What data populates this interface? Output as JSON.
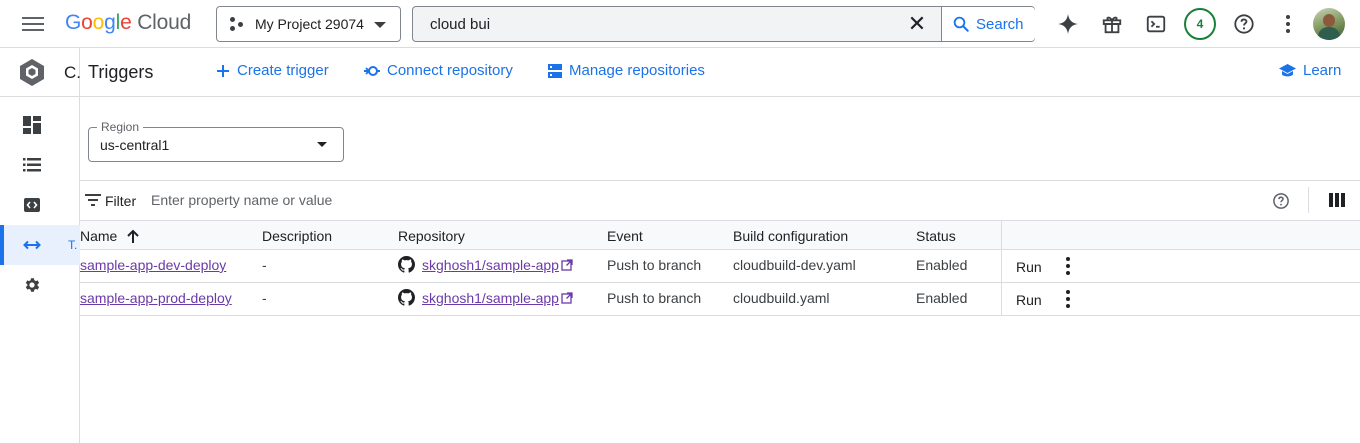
{
  "topbar": {
    "logo_google": "Google",
    "logo_cloud": "Cloud",
    "project_name": "My Project 29074",
    "search_value": "cloud bui",
    "search_button": "Search",
    "notifications_count": "4",
    "icons": [
      "menu-icon",
      "gemini-sparkle-icon",
      "gift-icon",
      "cloud-shell-icon",
      "help-icon",
      "more-vert-icon"
    ]
  },
  "rail": {
    "product_name": "C.",
    "items": [
      {
        "icon": "dashboard-icon"
      },
      {
        "icon": "history-list-icon"
      },
      {
        "icon": "code-icon"
      },
      {
        "icon": "triggers-arrow-icon",
        "label": "T.",
        "active": true
      },
      {
        "icon": "settings-gear-icon"
      }
    ]
  },
  "header": {
    "title": "Triggers",
    "create_trigger": "Create trigger",
    "connect_repository": "Connect repository",
    "manage_repositories": "Manage repositories",
    "learn": "Learn"
  },
  "region": {
    "label": "Region",
    "value": "us-central1"
  },
  "filter": {
    "label": "Filter",
    "placeholder": "Enter property name or value"
  },
  "table": {
    "columns": [
      "Name",
      "Description",
      "Repository",
      "Event",
      "Build configuration",
      "Status"
    ],
    "rows": [
      {
        "name": "sample-app-dev-deploy",
        "description": "-",
        "repository": "skghosh1/sample-app",
        "event": "Push to branch",
        "build_config": "cloudbuild-dev.yaml",
        "status": "Enabled",
        "action": "Run"
      },
      {
        "name": "sample-app-prod-deploy",
        "description": "-",
        "repository": "skghosh1/sample-app",
        "event": "Push to branch",
        "build_config": "cloudbuild.yaml",
        "status": "Enabled",
        "action": "Run"
      }
    ]
  },
  "colors": {
    "accent": "#1a73e8",
    "visited_link": "#6b3aa8",
    "badge_green": "#188038"
  }
}
